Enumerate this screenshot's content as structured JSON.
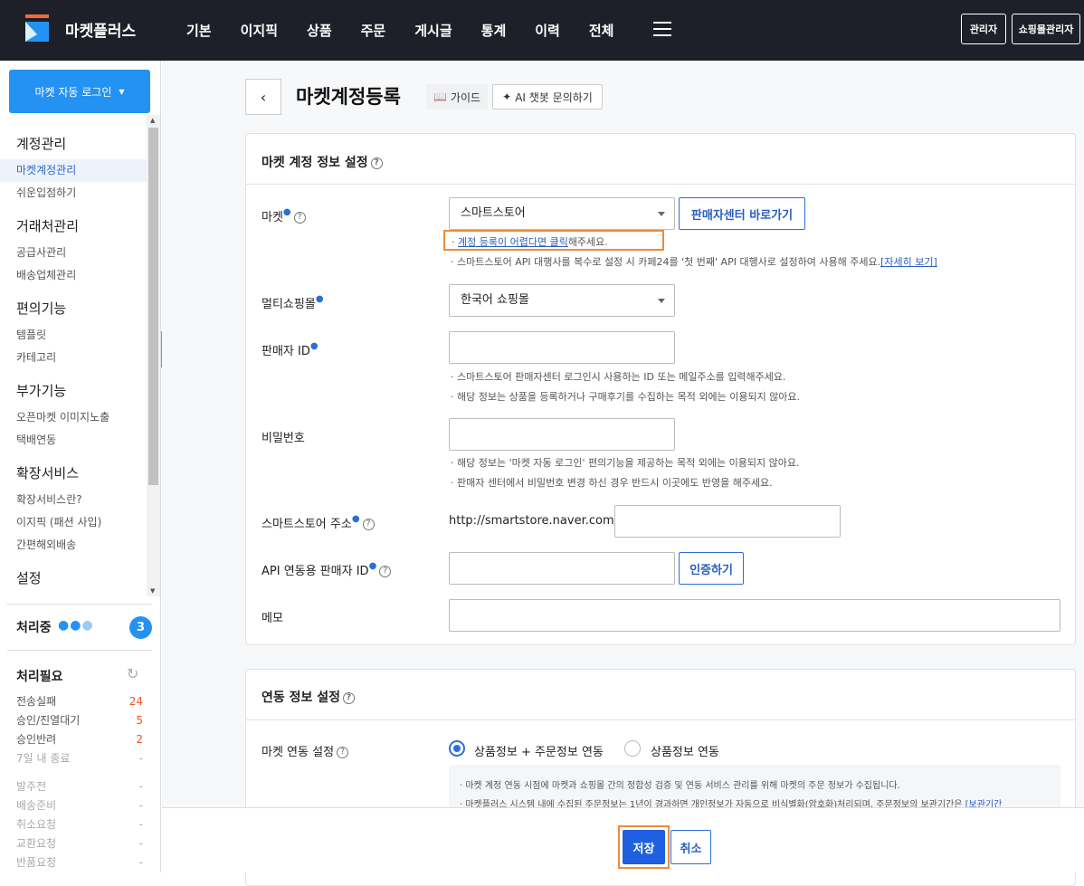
{
  "header": {
    "brand": "마켓플러스",
    "nav": [
      "기본",
      "이지픽",
      "상품",
      "주문",
      "게시글",
      "통계",
      "이력",
      "전체"
    ],
    "admin_btn": "관리자",
    "shop_admin_btn": "쇼핑몰관리자"
  },
  "sidebar": {
    "auto_login": "마켓 자동 로그인",
    "groups": [
      {
        "title": "계정관리",
        "items": [
          "마켓계정관리",
          "쉬운입점하기"
        ]
      },
      {
        "title": "거래처관리",
        "items": [
          "공급사관리",
          "배송업체관리"
        ]
      },
      {
        "title": "편의기능",
        "items": [
          "템플릿",
          "카테고리"
        ]
      },
      {
        "title": "부가기능",
        "items": [
          "오픈마켓 이미지노출",
          "택배연동"
        ]
      },
      {
        "title": "확장서비스",
        "items": [
          "확장서비스란?",
          "이지픽 (패션 사입)",
          "간편해외배송"
        ]
      },
      {
        "title": "설정",
        "items": []
      }
    ],
    "processing_label": "처리중",
    "processing_count": "3",
    "needs_label": "처리필요",
    "needs": [
      {
        "label": "전송실패",
        "value": "24"
      },
      {
        "label": "승인/진열대기",
        "value": "5"
      },
      {
        "label": "승인반려",
        "value": "2"
      },
      {
        "label": "7일 내 종료",
        "value": "-"
      },
      {
        "label": "발주전",
        "value": "-"
      },
      {
        "label": "배송준비",
        "value": "-"
      },
      {
        "label": "취소요청",
        "value": "-"
      },
      {
        "label": "교환요청",
        "value": "-"
      },
      {
        "label": "반품요청",
        "value": "-"
      }
    ]
  },
  "page": {
    "title": "마켓계정등록",
    "guide": "가이드",
    "ai_chat": "AI 챗봇 문의하기"
  },
  "account_section": {
    "title": "마켓 계정 정보 설정",
    "market_label": "마켓",
    "market_value": "스마트스토어",
    "seller_center_btn": "판매자센터 바로가기",
    "market_hint_link": "계정 등록이 어렵다면 클릭",
    "market_hint_suffix": "해주세요.",
    "market_hint2": "· 스마트스토어 API 대행사를 복수로 설정 시 카페24를 '첫 번째' API 대행사로 설정하여 사용해 주세요.",
    "market_hint2_link": "[자세히 보기]",
    "multishop_label": "멀티쇼핑몰",
    "multishop_value": "한국어 쇼핑몰",
    "seller_id_label": "판매자 ID",
    "seller_id_value": "",
    "seller_id_hint1": "· 스마트스토어 판매자센터 로그인시 사용하는 ID 또는 메일주소를 입력해주세요.",
    "seller_id_hint2": "· 해당 정보는 상품을 등록하거나 구매후기를 수집하는 목적 외에는 이용되지 않아요.",
    "password_label": "비밀번호",
    "password_value": "",
    "password_hint1": "· 해당 정보는 '마켓 자동 로그인' 편의기능을 제공하는 목적 외에는 이용되지 않아요.",
    "password_hint2": "· 판매자 센터에서 비밀번호 변경 하신 경우 반드시 이곳에도 반영을 해주세요.",
    "store_url_label": "스마트스토어 주소",
    "store_url_prefix": "http://smartstore.naver.com/",
    "store_url_value": "",
    "api_id_label": "API 연동용 판매자 ID",
    "api_id_value": "",
    "verify_btn": "인증하기",
    "memo_label": "메모",
    "memo_value": ""
  },
  "link_section": {
    "title": "연동 정보 설정",
    "link_label": "마켓 연동 설정",
    "option1": "상품정보 + 주문정보 연동",
    "option2": "상품정보 연동",
    "note1": "· 마켓 계정 연동 시점에 마켓과 쇼핑몰 간의 정합성 검증 및 연동 서비스 관리를 위해 마켓의 주문 정보가 수집됩니다.",
    "note2": "· 마켓플러스 시스템 내에 수집된 주문정보는 1년이 경과하면 개인정보가 자동으로 비식별화(암호화)처리되며, 주문정보의 보관기간은",
    "note2_link": "[보관기간"
  },
  "footer": {
    "save": "저장",
    "cancel": "취소"
  },
  "colors": {
    "topbar": "#1d2028",
    "primary": "#2492f2",
    "save": "#1f5fe0",
    "highlight": "#f08a3c",
    "count_badge": "#2492f2",
    "alert": "#e8572a"
  }
}
